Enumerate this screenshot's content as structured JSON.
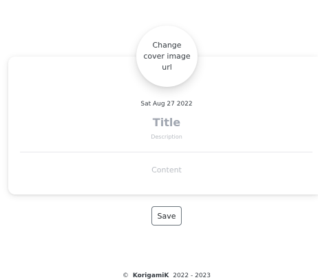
{
  "cover": {
    "label": "Change cover image url"
  },
  "post": {
    "date": "Sat Aug 27 2022",
    "title_placeholder": "Title",
    "description_placeholder": "Description",
    "content_placeholder": "Content"
  },
  "actions": {
    "save_label": "Save"
  },
  "footer": {
    "copyright_symbol": "©",
    "brand": "KorigamiK",
    "years": "2022 - 2023"
  }
}
